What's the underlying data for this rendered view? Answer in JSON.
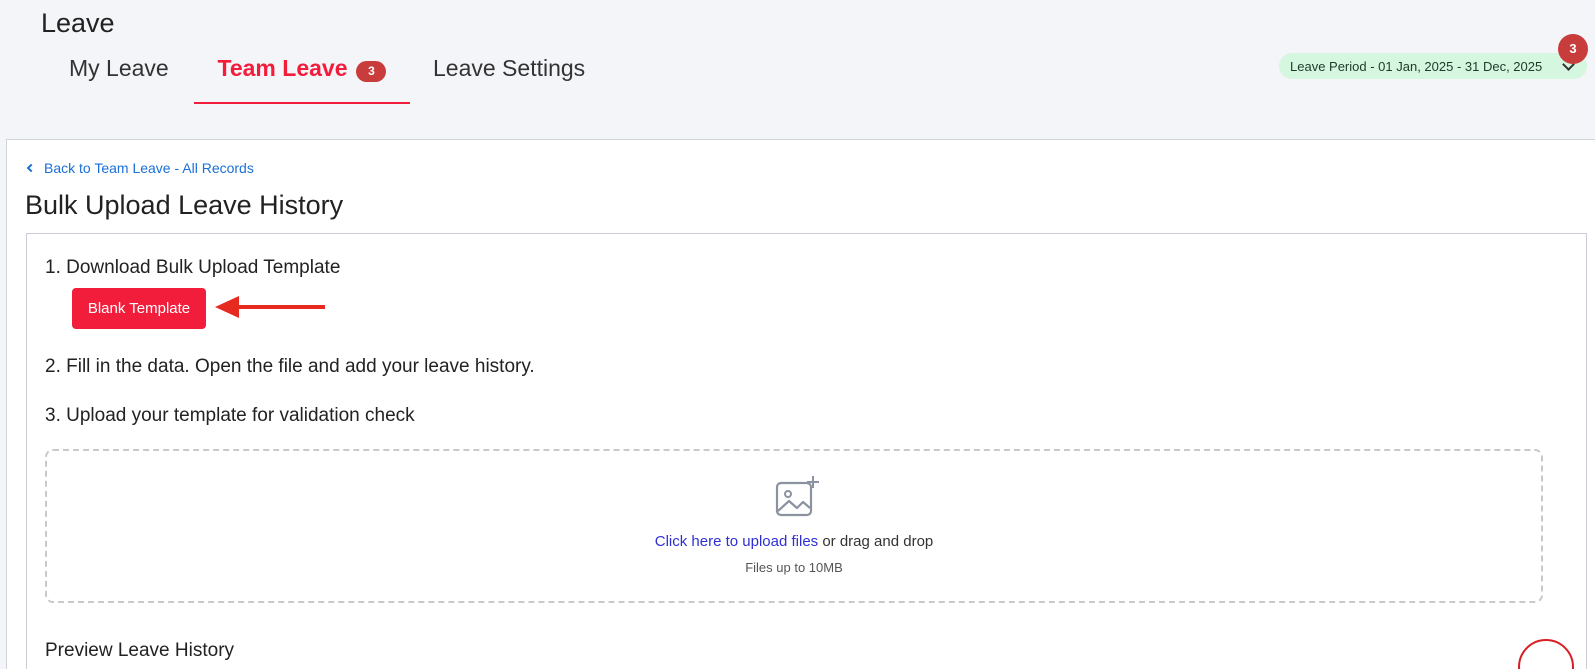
{
  "header": {
    "title": "Leave",
    "tabs": [
      {
        "label": "My Leave"
      },
      {
        "label": "Team Leave",
        "badge": "3"
      },
      {
        "label": "Leave Settings"
      }
    ],
    "period": {
      "label": "Leave Period - 01 Jan, 2025 - 31 Dec, 2025",
      "badge": "3"
    }
  },
  "main": {
    "back_link": "Back to Team Leave - All Records",
    "page_title": "Bulk Upload Leave History",
    "steps": {
      "step1": "1. Download Bulk Upload Template",
      "blank_template_button": "Blank Template",
      "step2": "2. Fill in the data. Open the file and add your leave history.",
      "step3": "3. Upload your template for validation check"
    },
    "dropzone": {
      "link_text": "Click here to upload files",
      "rest_text": " or drag and drop",
      "subtext": "Files up to 10MB",
      "icon": "image-plus-icon"
    },
    "preview_title": "Preview Leave History"
  },
  "colors": {
    "accent": "#f21d3b",
    "badge": "#c93c3c",
    "link": "#1a6fd8",
    "period_bg": "#d5f6df"
  }
}
